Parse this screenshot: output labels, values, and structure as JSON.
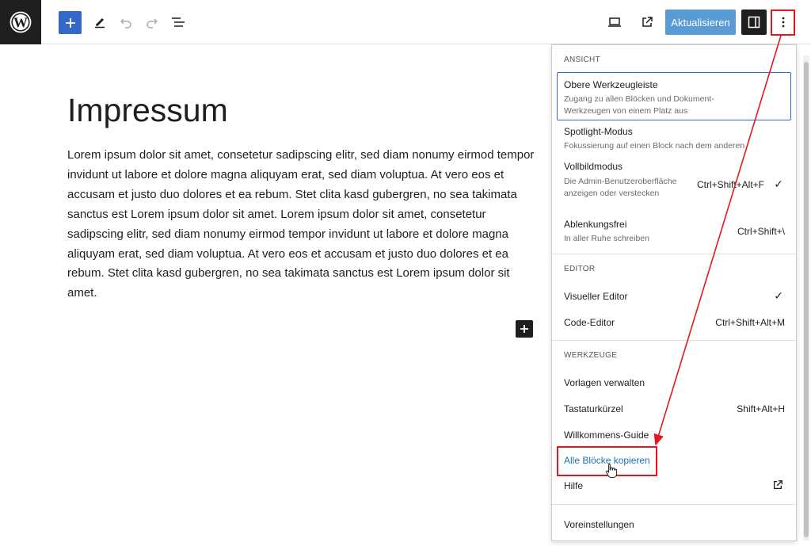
{
  "toolbar": {
    "logo_icon": "wordpress-logo",
    "update_label": "Aktualisieren",
    "accent": "#3368c8",
    "update_bg": "#5b9bd5"
  },
  "page": {
    "title": "Impressum",
    "paragraph": "Lorem ipsum dolor sit amet, consetetur sadipscing elitr, sed diam nonumy eirmod tempor invidunt ut labore et dolore magna aliquyam erat, sed diam voluptua. At vero eos et accusam et justo duo dolores et ea rebum. Stet clita kasd gubergren, no sea takimata sanctus est Lorem ipsum dolor sit amet. Lorem ipsum dolor sit amet, consetetur sadipscing elitr, sed diam nonumy eirmod tempor invidunt ut labore et dolore magna aliquyam erat, sed diam voluptua. At vero eos et accusam et justo duo dolores et ea rebum. Stet clita kasd gubergren, no sea takimata sanctus est Lorem ipsum dolor sit amet."
  },
  "menu": {
    "view": {
      "label": "Ansicht",
      "top_toolbar": {
        "label": "Obere Werkzeugleiste",
        "help": "Zugang zu allen Blöcken und Dokument-Werkzeugen von einem Platz aus"
      },
      "spotlight": {
        "label": "Spotlight-Modus",
        "help": "Fokussierung auf einen Block nach dem anderen"
      },
      "fullscreen": {
        "label": "Vollbildmodus",
        "help": "Die Admin-Benutzeroberfläche anzeigen oder verstecken",
        "shortcut": "Ctrl+Shift+Alt+F",
        "checked": "✓"
      },
      "distraction_free": {
        "label": "Ablenkungsfrei",
        "help": "In aller Ruhe schreiben",
        "shortcut": "Ctrl+Shift+\\"
      }
    },
    "editor": {
      "label": "Editor",
      "visual": {
        "label": "Visueller Editor",
        "checked": "✓"
      },
      "code": {
        "label": "Code-Editor",
        "shortcut": "Ctrl+Shift+Alt+M"
      }
    },
    "tools": {
      "label": "Werkzeuge",
      "templates": {
        "label": "Vorlagen verwalten"
      },
      "shortcuts": {
        "label": "Tastaturkürzel",
        "shortcut": "Shift+Alt+H"
      },
      "welcome": {
        "label": "Willkommens-Guide"
      },
      "copy_all": {
        "label": "Alle Blöcke kopieren"
      },
      "help": {
        "label": "Hilfe",
        "icon": "external-link-icon"
      }
    },
    "preferences": {
      "label": "Voreinstellungen"
    }
  },
  "annotation": {
    "color": "#e3181f"
  }
}
